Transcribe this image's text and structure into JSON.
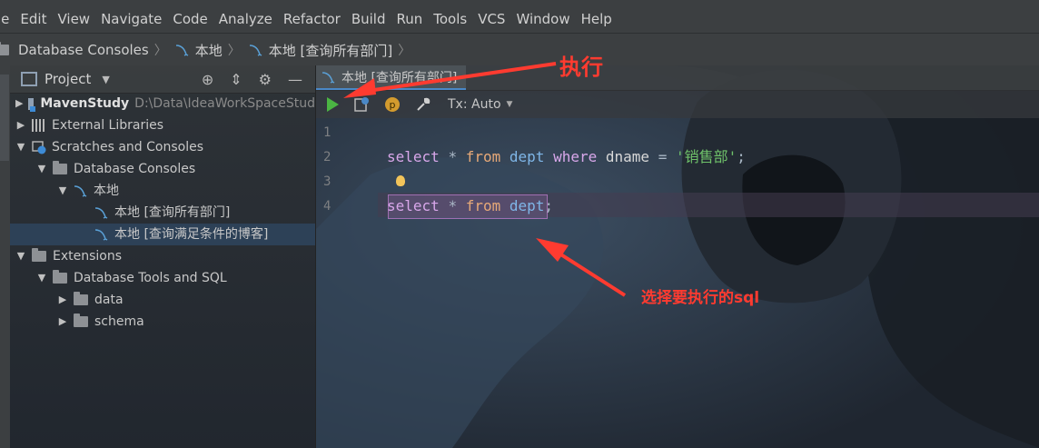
{
  "menu": [
    "le",
    "Edit",
    "View",
    "Navigate",
    "Code",
    "Analyze",
    "Refactor",
    "Build",
    "Run",
    "Tools",
    "VCS",
    "Window",
    "Help"
  ],
  "breadcrumb": [
    {
      "label": "Database Consoles",
      "icon": "folder-icon"
    },
    {
      "label": "本地",
      "icon": "mysql-icon"
    },
    {
      "label": "本地 [查询所有部门]",
      "icon": "mysql-icon"
    }
  ],
  "project_panel": {
    "title": "Project",
    "tree": [
      {
        "label": "MavenStudy",
        "detail": "D:\\Data\\IdeaWorkSpaceStud",
        "level": 0,
        "arrow": "▶",
        "icon": "module-icon",
        "bold": true
      },
      {
        "label": "External Libraries",
        "level": 0,
        "arrow": "▶",
        "icon": "library-icon"
      },
      {
        "label": "Scratches and Consoles",
        "level": 0,
        "arrow": "▼",
        "icon": "scratch-icon"
      },
      {
        "label": "Database Consoles",
        "level": 1,
        "arrow": "▼",
        "icon": "folder-icon"
      },
      {
        "label": "本地",
        "level": 2,
        "arrow": "▼",
        "icon": "mysql-icon"
      },
      {
        "label": "本地 [查询所有部门]",
        "level": 3,
        "arrow": "",
        "icon": "mysql-icon"
      },
      {
        "label": "本地 [查询满足条件的博客]",
        "level": 3,
        "arrow": "",
        "icon": "mysql-icon",
        "selected": true
      },
      {
        "label": "Extensions",
        "level": 0,
        "arrow": "▼",
        "icon": "folder-icon"
      },
      {
        "label": "Database Tools and SQL",
        "level": 1,
        "arrow": "▼",
        "icon": "folder-icon"
      },
      {
        "label": "data",
        "level": 2,
        "arrow": "▶",
        "icon": "folder-icon"
      },
      {
        "label": "schema",
        "level": 2,
        "arrow": "▶",
        "icon": "folder-icon"
      }
    ]
  },
  "editor": {
    "tab_label": "本地 [查询所有部门]",
    "tx_mode": "Tx: Auto",
    "line_numbers": [
      "1",
      "2",
      "3",
      "4"
    ],
    "line2": {
      "k1": "select",
      "star": "*",
      "k2": "from",
      "t": "dept",
      "k3": "where",
      "c": "dname",
      "eq": "=",
      "s": "'销售部'",
      "end": ";"
    },
    "line4": {
      "k1": "select",
      "star": "*",
      "k2": "from",
      "t": "dept",
      "end": ";"
    }
  },
  "annotations": {
    "execute": "执行",
    "select_sql": "选择要执行的sql"
  },
  "colors": {
    "annotation": "#ff3b30",
    "run_green": "#4bb543"
  }
}
